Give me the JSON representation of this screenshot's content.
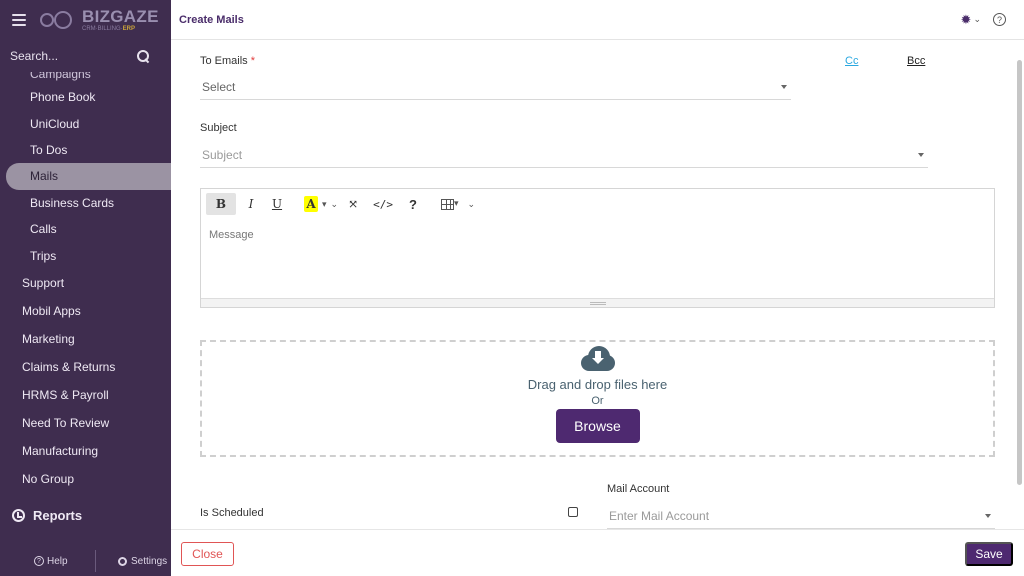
{
  "sidebar": {
    "logo": {
      "name": "BIZGAZE",
      "sub_prefix": "CRM·BILLING·",
      "sub_highlight": "ERP"
    },
    "search_placeholder": "Search...",
    "cut_item": "Campaigns",
    "items": [
      {
        "label": "Phone Book"
      },
      {
        "label": "UniCloud"
      },
      {
        "label": "To Dos"
      },
      {
        "label": "Mails",
        "active": true
      },
      {
        "label": "Business Cards"
      },
      {
        "label": "Calls"
      },
      {
        "label": "Trips"
      }
    ],
    "groups": [
      {
        "label": "Support"
      },
      {
        "label": "Mobil Apps"
      },
      {
        "label": "Marketing"
      },
      {
        "label": "Claims & Returns"
      },
      {
        "label": "HRMS & Payroll"
      },
      {
        "label": "Need To Review"
      },
      {
        "label": "Manufacturing"
      },
      {
        "label": "No Group"
      }
    ],
    "reports_label": "Reports",
    "help_label": "Help",
    "settings_label": "Settings"
  },
  "header": {
    "title": "Create Mails"
  },
  "form": {
    "to_emails_label": "To Emails",
    "required_mark": "*",
    "to_emails_value": "Select",
    "cc_label": "Cc",
    "bcc_label": "Bcc",
    "subject_label": "Subject",
    "subject_placeholder": "Subject",
    "editor": {
      "toolbar": {
        "bold": "B",
        "italic": "I",
        "underline": "U",
        "highlight": "A",
        "code": "</>",
        "help": "?"
      },
      "message_placeholder": "Message"
    },
    "dropzone": {
      "text": "Drag and drop files here",
      "or": "Or",
      "browse_label": "Browse"
    },
    "is_scheduled_label": "Is Scheduled",
    "mail_account_label": "Mail Account",
    "mail_account_placeholder": "Enter Mail Account"
  },
  "footer": {
    "close_label": "Close",
    "save_label": "Save"
  },
  "colors": {
    "sidebar_bg": "#3f2d4f",
    "brand_purple": "#4e2970",
    "link_blue": "#2aa8e0",
    "close_red": "#e05555"
  }
}
